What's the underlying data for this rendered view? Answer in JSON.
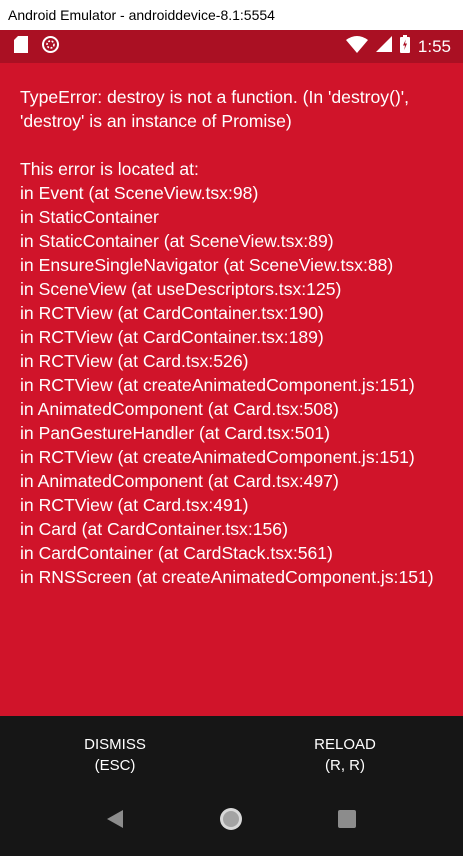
{
  "window": {
    "title": "Android Emulator - androiddevice-8.1:5554"
  },
  "statusbar": {
    "time": "1:55",
    "left_icons": [
      "sd-card-icon",
      "app-notification-icon"
    ],
    "right_icons": [
      "wifi-icon",
      "cellular-signal-icon",
      "battery-icon"
    ]
  },
  "error": {
    "message": "TypeError: destroy is not a function. (In 'destroy()', 'destroy' is an instance of Promise)",
    "located_header": "This error is located at:",
    "stack": [
      "in Event (at SceneView.tsx:98)",
      "in StaticContainer",
      "in StaticContainer (at SceneView.tsx:89)",
      "in EnsureSingleNavigator (at SceneView.tsx:88)",
      "in SceneView (at useDescriptors.tsx:125)",
      "in RCTView (at CardContainer.tsx:190)",
      "in RCTView (at CardContainer.tsx:189)",
      "in RCTView (at Card.tsx:526)",
      "in RCTView (at createAnimatedComponent.js:151)",
      "in AnimatedComponent (at Card.tsx:508)",
      "in PanGestureHandler (at Card.tsx:501)",
      "in RCTView (at createAnimatedComponent.js:151)",
      "in AnimatedComponent (at Card.tsx:497)",
      "in RCTView (at Card.tsx:491)",
      "in Card (at CardContainer.tsx:156)",
      "in CardContainer (at CardStack.tsx:561)",
      "in RNSScreen (at createAnimatedComponent.js:151)"
    ]
  },
  "actions": {
    "dismiss_label": "DISMISS",
    "dismiss_shortcut": "(ESC)",
    "reload_label": "RELOAD",
    "reload_shortcut": "(R, R)"
  },
  "navbar": {
    "buttons": [
      "back-icon",
      "home-icon",
      "recents-icon"
    ]
  },
  "colors": {
    "error_background": "#d0142a",
    "statusbar_background": "#aa1023",
    "action_area_background": "#161616",
    "text": "#ffffff"
  }
}
